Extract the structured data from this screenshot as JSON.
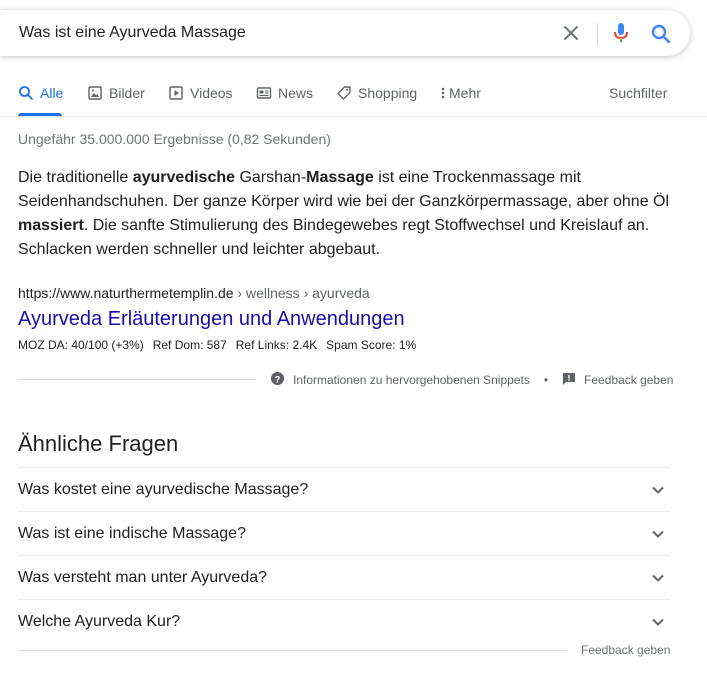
{
  "search": {
    "query": "Was ist eine Ayurveda Massage"
  },
  "tabs": {
    "items": [
      {
        "label": "Alle"
      },
      {
        "label": "Bilder"
      },
      {
        "label": "Videos"
      },
      {
        "label": "News"
      },
      {
        "label": "Shopping"
      },
      {
        "label": "Mehr"
      }
    ],
    "filters_label": "Suchfilter"
  },
  "stats": "Ungefähr 35.000.000 Ergebnisse (0,82 Sekunden)",
  "snippet": {
    "t1": "Die traditionelle ",
    "b1": "ayurvedische",
    "t2": " Garshan-",
    "b2": "Massage",
    "t3": " ist eine Trockenmassage mit Seidenhandschuhen. Der ganze Körper wird wie bei der Ganzkörpermassage, aber ohne Öl ",
    "b3": "massiert",
    "t4": ". Die sanfte Stimulierung des Bindegewebes regt Stoffwechsel und Kreislauf an. Schlacken werden schneller und leichter abgebaut."
  },
  "result": {
    "cite_domain": "https://www.naturthermetemplin.de",
    "cite_path": " › wellness › ayurveda",
    "title": "Ayurveda Erläuterungen und Anwendungen",
    "seo": {
      "moz": "MOZ DA: 40/100 (+3%)",
      "ref_dom": "Ref Dom: 587",
      "ref_links": "Ref Links: 2.4K",
      "spam": "Spam Score: 1%"
    }
  },
  "snippet_footer": {
    "info": "Informationen zu hervorgehobenen Snippets",
    "separator": "•",
    "feedback": "Feedback geben"
  },
  "paa": {
    "title": "Ähnliche Fragen",
    "questions": [
      "Was kostet eine ayurvedische Massage?",
      "Was ist eine indische Massage?",
      "Was versteht man unter Ayurveda?",
      "Welche Ayurveda Kur?"
    ],
    "feedback": "Feedback geben"
  },
  "colors": {
    "accent": "#1a73e8",
    "link": "#1a0dab",
    "text": "#202124",
    "muted": "#70757a"
  }
}
